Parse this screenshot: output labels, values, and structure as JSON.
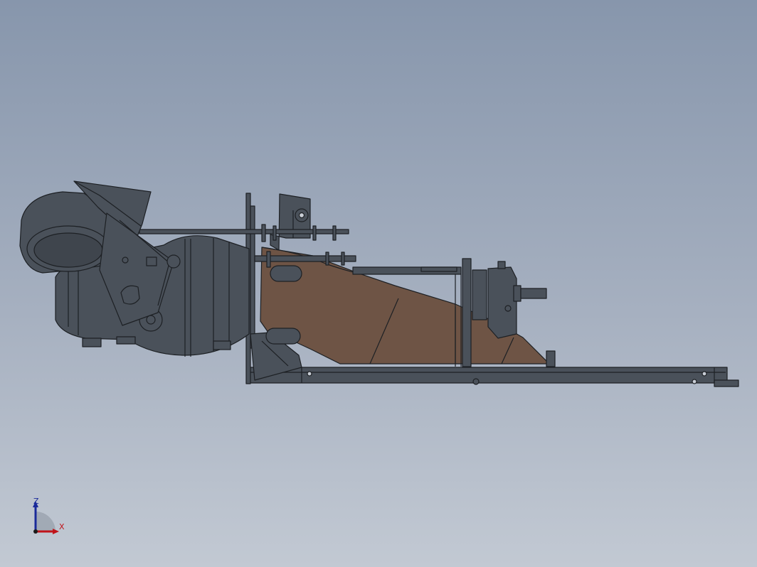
{
  "viewport": {
    "background_top": "#8796ac",
    "background_bottom": "#c2c9d3"
  },
  "model": {
    "body_color": "#4a515a",
    "edge_color": "#1d2024",
    "duct_color": "#6e5445"
  },
  "triad": {
    "z_label": "Z",
    "x_label": "X",
    "z_color": "#1a2a9a",
    "x_color": "#c0141a"
  }
}
